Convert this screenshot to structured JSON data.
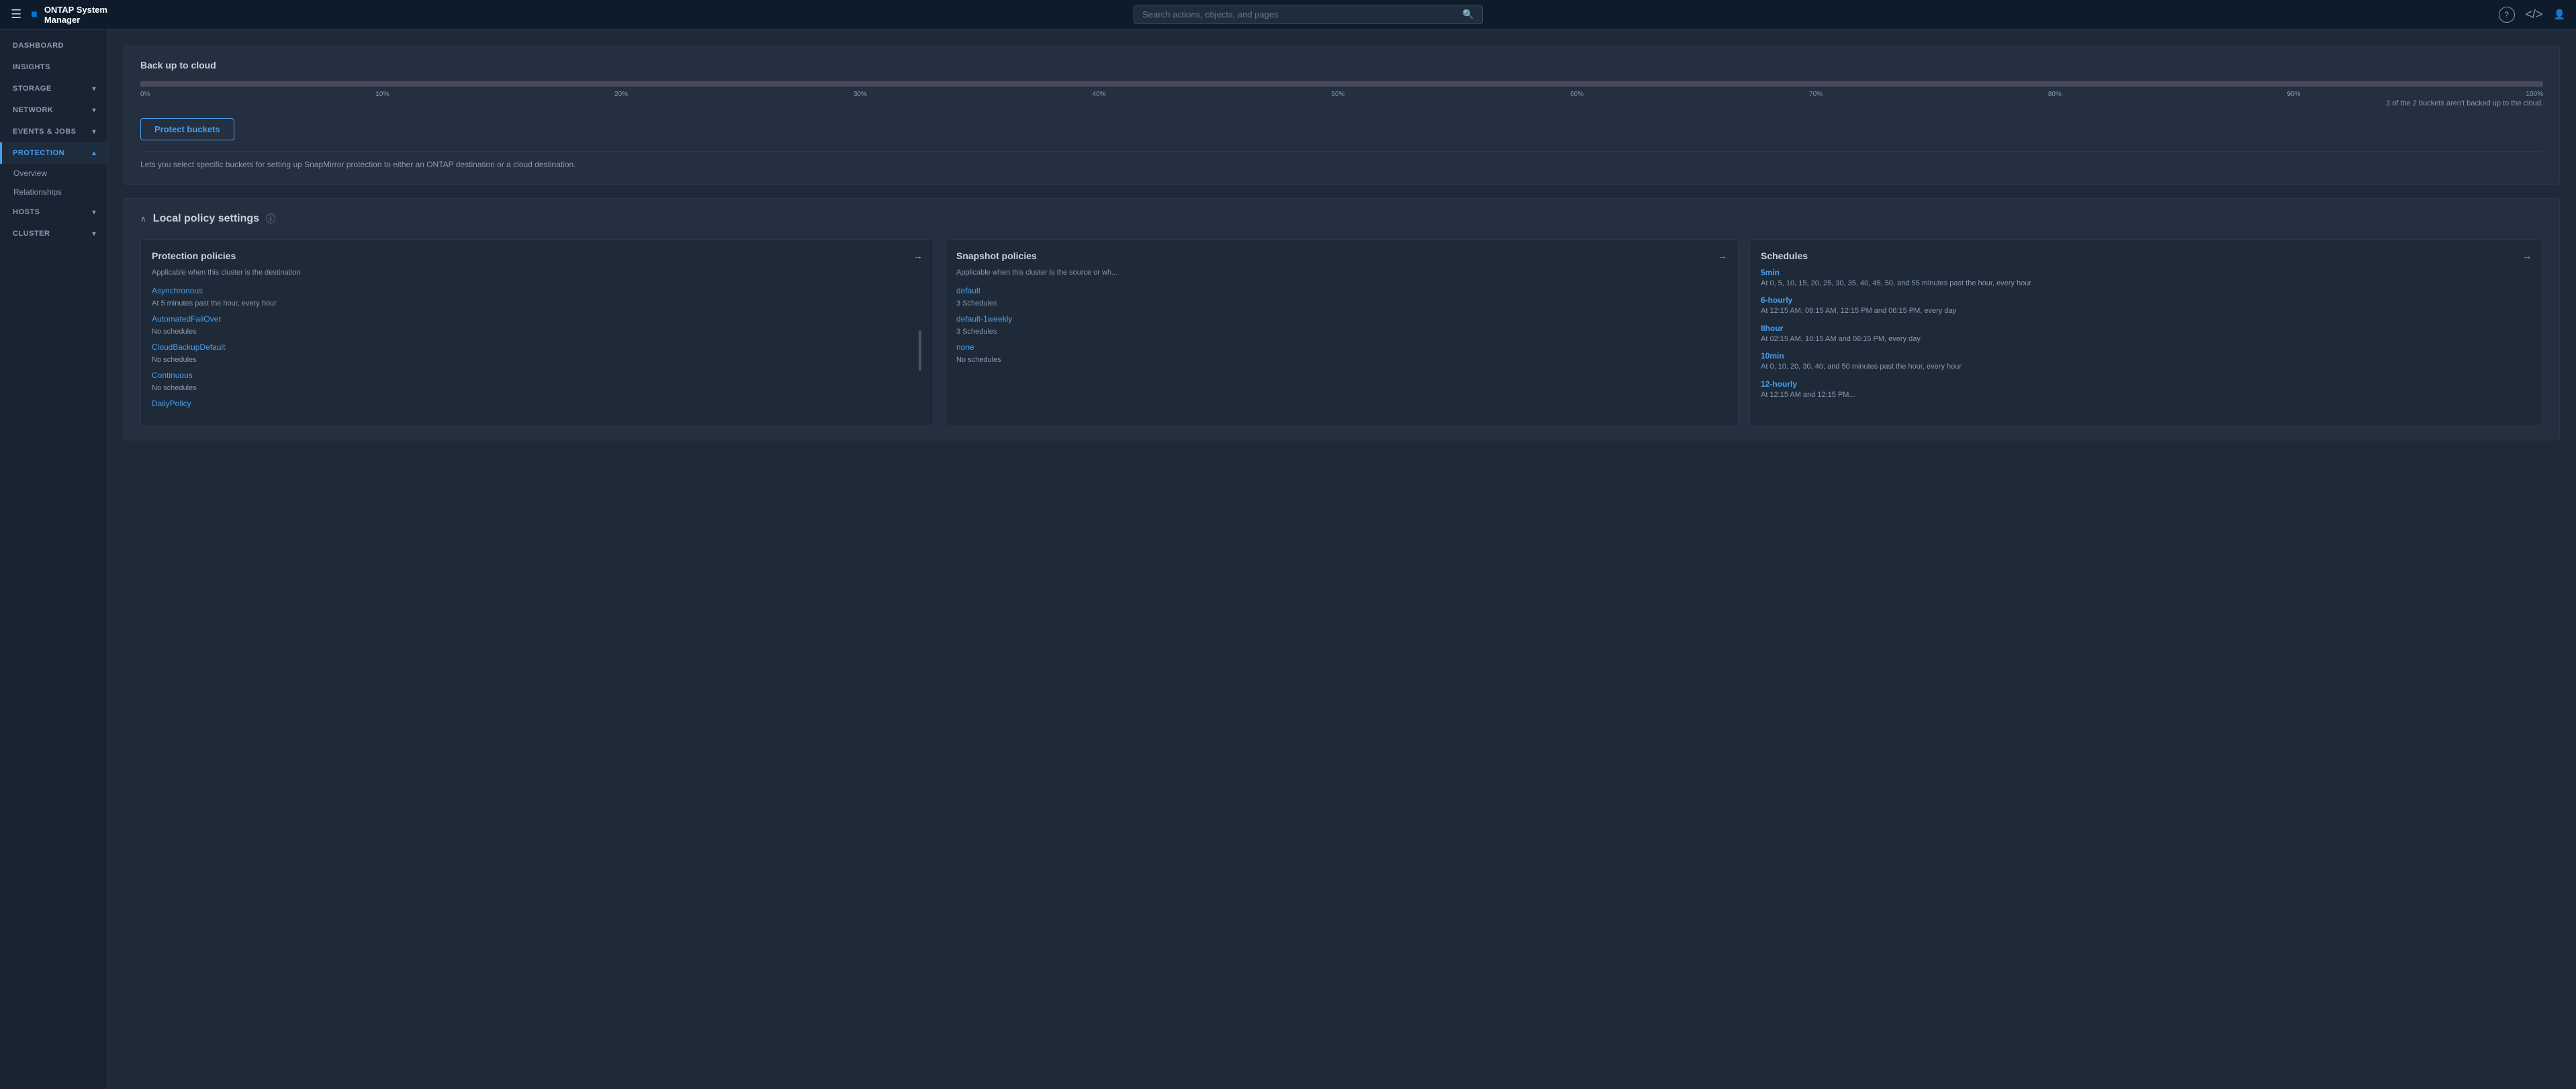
{
  "app": {
    "title": "ONTAP System Manager",
    "logo_icon": "■"
  },
  "topbar": {
    "search_placeholder": "Search actions, objects, and pages",
    "help_icon": "?",
    "code_icon": "</>",
    "user_icon": "👤"
  },
  "sidebar": {
    "items": [
      {
        "id": "dashboard",
        "label": "DASHBOARD",
        "has_children": false,
        "active": false
      },
      {
        "id": "insights",
        "label": "INSIGHTS",
        "has_children": false,
        "active": false
      },
      {
        "id": "storage",
        "label": "STORAGE",
        "has_children": true,
        "active": false
      },
      {
        "id": "network",
        "label": "NETWORK",
        "has_children": true,
        "active": false
      },
      {
        "id": "events-jobs",
        "label": "EVENTS & JOBS",
        "has_children": true,
        "active": false
      },
      {
        "id": "protection",
        "label": "PROTECTION",
        "has_children": true,
        "active": true
      },
      {
        "id": "hosts",
        "label": "HOSTS",
        "has_children": true,
        "active": false
      },
      {
        "id": "cluster",
        "label": "CLUSTER",
        "has_children": true,
        "active": false
      }
    ],
    "sub_items": [
      {
        "id": "overview",
        "label": "Overview",
        "active": false,
        "parent": "protection"
      },
      {
        "id": "relationships",
        "label": "Relationships",
        "active": false,
        "parent": "protection"
      }
    ]
  },
  "backup_section": {
    "title": "Back up to cloud",
    "progress_labels": [
      "0%",
      "10%",
      "20%",
      "30%",
      "40%",
      "50%",
      "60%",
      "70%",
      "80%",
      "90%",
      "100%"
    ],
    "progress_note": "2 of the 2 buckets aren't backed up to the cloud.",
    "protect_btn_label": "Protect buckets",
    "description": "Lets you select specific buckets for setting up SnapMirror protection to either an ONTAP destination or a cloud destination."
  },
  "local_policy": {
    "title": "Local policy settings",
    "collapse_icon": "∧",
    "cards": [
      {
        "id": "protection-policies",
        "title": "Protection policies",
        "arrow": "→",
        "subtitle": "Applicable when this cluster is the destination",
        "entries": [
          {
            "name": "Asynchronous",
            "detail": "At 5 minutes past the hour, every hour"
          },
          {
            "name": "AutomatedFailOver",
            "detail": "No schedules"
          },
          {
            "name": "CloudBackupDefault",
            "detail": "No schedules"
          },
          {
            "name": "Continuous",
            "detail": "No schedules"
          },
          {
            "name": "DailyPolicy",
            "detail": ""
          }
        ]
      },
      {
        "id": "snapshot-policies",
        "title": "Snapshot policies",
        "arrow": "→",
        "subtitle": "Applicable when this cluster is the source or wh...",
        "entries": [
          {
            "name": "default",
            "detail": "3 Schedules"
          },
          {
            "name": "default-1weekly",
            "detail": "3 Schedules"
          },
          {
            "name": "none",
            "detail": "No schedules"
          }
        ]
      },
      {
        "id": "schedules",
        "title": "Schedules",
        "arrow": "→",
        "entries": [
          {
            "name": "5min",
            "detail": "At 0, 5, 10, 15, 20, 25, 30, 35, 40, 45, 50, and 55 minutes past the hour, every hour"
          },
          {
            "name": "6-hourly",
            "detail": "At 12:15 AM, 06:15 AM, 12:15 PM and 06:15 PM, every day"
          },
          {
            "name": "8hour",
            "detail": "At 02:15 AM, 10:15 AM and 06:15 PM, every day"
          },
          {
            "name": "10min",
            "detail": "At 0, 10, 20, 30, 40, and 50 minutes past the hour, every hour"
          },
          {
            "name": "12-hourly",
            "detail": "At 12:15 AM and 12:15 PM..."
          }
        ]
      }
    ]
  }
}
